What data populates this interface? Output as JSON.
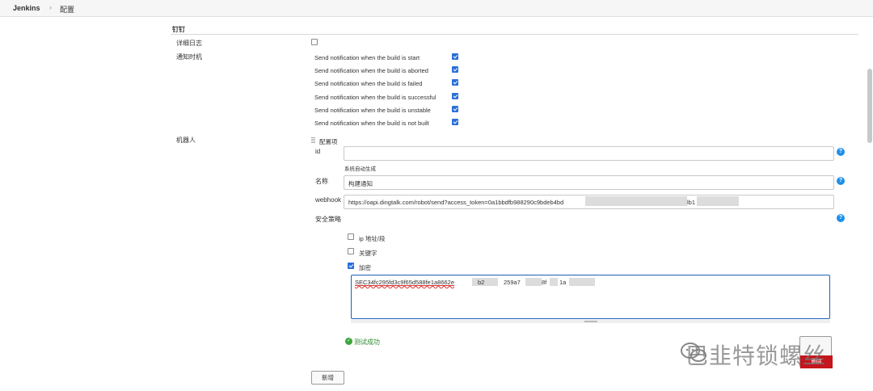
{
  "breadcrumb": {
    "home": "Jenkins",
    "separator": "›",
    "current": "配置"
  },
  "section": {
    "title": "钉钉"
  },
  "verbose_log": {
    "label": "详细日志",
    "checked": false
  },
  "notify": {
    "label": "通知时机",
    "options": [
      {
        "label": "Send notification when the build is start",
        "checked": true
      },
      {
        "label": "Send notification when the build is aborted",
        "checked": true
      },
      {
        "label": "Send notification when the build is failed",
        "checked": true
      },
      {
        "label": "Send notification when the build is successful",
        "checked": true
      },
      {
        "label": "Send notification when the build is unstable",
        "checked": true
      },
      {
        "label": "Send notification when the build is not built",
        "checked": true
      }
    ]
  },
  "robot": {
    "label": "机器人",
    "config_title": "配置项",
    "id_label": "id",
    "id_value": "",
    "id_hint": "系统自动生成",
    "name_label": "名称",
    "name_value": "构建通知",
    "webhook_label": "webhook",
    "webhook_value": "https://oapi.dingtalk.com/robot/send?access_token=0a1bbdfb988290c9bdeb4bd",
    "webhook_tail": "lb1",
    "security_label": "安全策略",
    "security_options": [
      {
        "label": "ip 地址/段",
        "checked": false
      },
      {
        "label": "关键字",
        "checked": false
      },
      {
        "label": "加密",
        "checked": true
      }
    ],
    "secret_value": "SEC34fc295fd3c9f65d588fe1a8662e",
    "secret_fragments": [
      "b2",
      "259a7",
      "8f",
      "1a"
    ],
    "test_result": "测试成功",
    "help_icon_text": "?"
  },
  "buttons": {
    "add": "新增",
    "delete": "删除"
  },
  "watermark": "巴韭特锁螺丝",
  "colors": {
    "checkbox": "#2a6fdb",
    "help": "#1d8fe8",
    "success": "#3ca53c",
    "danger": "#c4161c"
  }
}
